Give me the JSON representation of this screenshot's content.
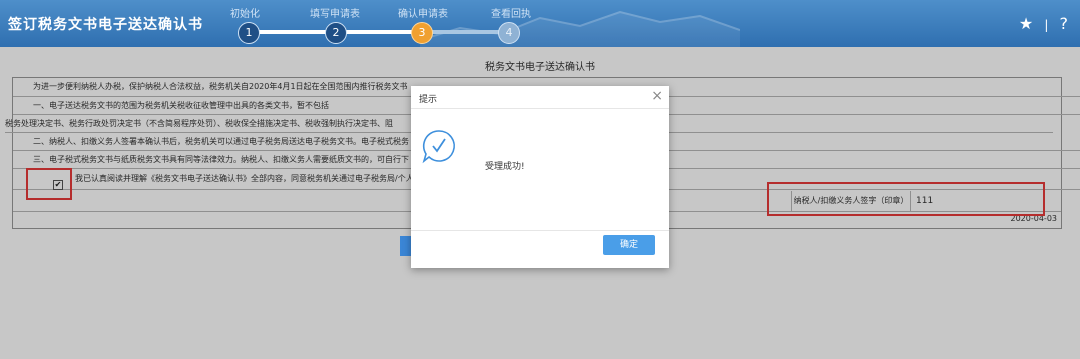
{
  "header": {
    "title": "签订税务文书电子送达确认书",
    "steps": [
      {
        "number": "1",
        "label": "初始化"
      },
      {
        "number": "2",
        "label": "填写申请表"
      },
      {
        "number": "3",
        "label": "确认申请表"
      },
      {
        "number": "4",
        "label": "查看回执"
      }
    ],
    "icons": [
      "star-icon",
      "help-icon"
    ],
    "icon_glyphs": {
      "star": "★",
      "divider": "|",
      "help": "?"
    }
  },
  "document": {
    "title": "税务文书电子送达确认书",
    "rows": [
      "为进一步便利纳税人办税，保护纳税人合法权益，税务机关自2020年4月1日起在全国范围内推行税务文书",
      "一、电子送达税务文书的范围为税务机关税收征收管理中出具的各类文书，暂不包括",
      "税务处理决定书、税务行政处罚决定书（不含简易程序处罚）、税收保全措施决定书、税收强制执行决定书、阻",
      "二、纳税人、扣缴义务人签署本确认书后，税务机关可以通过电子税务局送达电子税务文书。电子税式税务",
      "三、电子税式税务文书与纸质税务文书具有同等法律效力。纳税人、扣缴义务人需要纸质文书的，可自行下",
      "我已认真阅读并理解《税务文书电子送达确认书》全部内容，同意税务机关通过电子税务局/个人"
    ],
    "agree_checked": "✔",
    "signature_label": "纳税人/扣缴义务人签字（印章）",
    "signature_value": "111",
    "date": "2020-04-03"
  },
  "dialog": {
    "title": "提示",
    "close_glyph": "×",
    "icon": "success-chat-check-icon",
    "message": "受理成功!",
    "ok_label": "确定"
  },
  "colors": {
    "header_bg": "#3b7cbf",
    "active_step": "#f0a030",
    "highlight": "#e83a3a",
    "primary_button": "#4a9ee8"
  }
}
